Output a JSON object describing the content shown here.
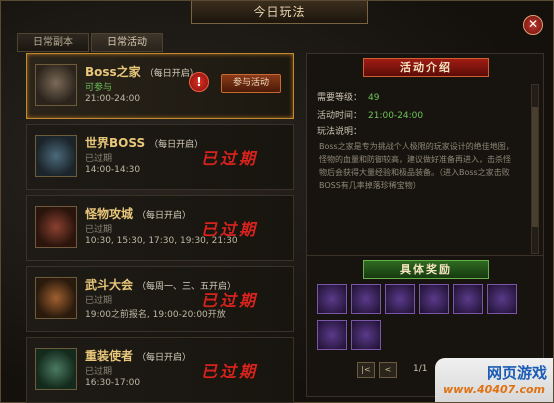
{
  "window": {
    "title": "今日玩法",
    "close_symbol": "✕"
  },
  "tabs": [
    {
      "label": "日常副本"
    },
    {
      "label": "日常活动"
    }
  ],
  "activities": [
    {
      "name": "Boss之家",
      "note": "（每日开启）",
      "status": "可参与",
      "time": "21:00-24:00",
      "join_label": "参与活动",
      "alert": "!"
    },
    {
      "name": "世界BOSS",
      "note": "（每日开启）",
      "status": "已过期",
      "time": "14:00-14:30",
      "expired_label": "已过期"
    },
    {
      "name": "怪物攻城",
      "note": "（每日开启）",
      "status": "已过期",
      "time": "10:30, 15:30, 17:30, 19:30, 21:30",
      "expired_label": "已过期"
    },
    {
      "name": "武斗大会",
      "note": "（每周一、三、五开启）",
      "status": "已过期",
      "time": "19:00之前报名, 19:00-20:00开放",
      "expired_label": "已过期"
    },
    {
      "name": "重装使者",
      "note": "（每日开启）",
      "status": "已过期",
      "time": "16:30-17:00",
      "expired_label": "已过期"
    }
  ],
  "intro": {
    "banner": "活动介绍",
    "level_label": "需要等级：",
    "level_value": "49",
    "time_label": "活动时间：",
    "time_value": "21:00-24:00",
    "desc_label": "玩法说明：",
    "desc": "Boss之家是专为挑战个人极限的玩家设计的绝佳地图，怪物的血量和防御较高，建议做好准备再进入，击杀怪物后会获得大量经验和极品装备。（进入Boss之家击败BOSS有几率掉落珍稀宝物）"
  },
  "rewards": {
    "banner": "具体奖励",
    "page": "1/1",
    "first_label": "|<",
    "prev_label": "<"
  },
  "watermark": {
    "line1": "网页游戏",
    "line2": "www.40407.com"
  }
}
